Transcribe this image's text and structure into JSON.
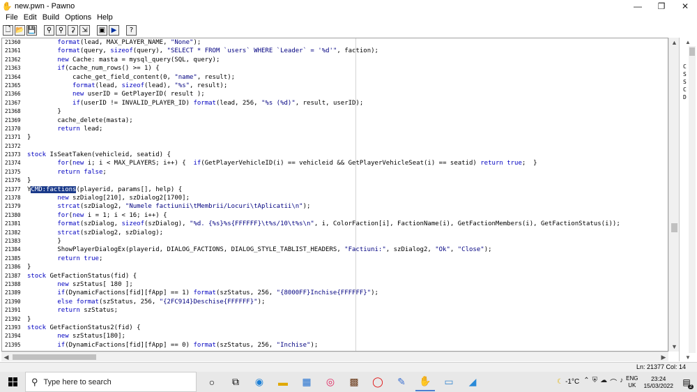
{
  "window": {
    "title": "new.pwn - Pawno",
    "app_icon": "pawno-hand-icon",
    "controls": {
      "minimize": "—",
      "restore": "❐",
      "close": "✕"
    }
  },
  "menu": [
    "File",
    "Edit",
    "Build",
    "Options",
    "Help"
  ],
  "toolbar": {
    "buttons": [
      {
        "name": "new-file-button",
        "icon": "new-icon",
        "glyph": "🗋"
      },
      {
        "name": "open-file-button",
        "icon": "open-folder-icon",
        "glyph": "📂"
      },
      {
        "name": "save-file-button",
        "icon": "save-icon",
        "glyph": "💾"
      },
      {
        "name": "find-button",
        "icon": "binoculars-icon",
        "glyph": "⚲"
      },
      {
        "name": "find-next-button",
        "icon": "find-next-icon",
        "glyph": "⚲"
      },
      {
        "name": "replace-button",
        "icon": "replace-icon",
        "glyph": "⚳"
      },
      {
        "name": "goto-line-button",
        "icon": "goto-icon",
        "glyph": "⇲"
      },
      {
        "name": "compile-button",
        "icon": "compile-icon",
        "glyph": "▣"
      },
      {
        "name": "run-button",
        "icon": "run-icon",
        "glyph": "▶"
      },
      {
        "name": "help-button",
        "icon": "help-icon",
        "glyph": "?"
      }
    ]
  },
  "editor": {
    "lines": [
      {
        "n": "21360",
        "t": "        format(lead, MAX_PLAYER_NAME, \"None\");"
      },
      {
        "n": "21361",
        "t": "        format(query, sizeof(query), \"SELECT * FROM `users` WHERE `Leader` = '%d'\", faction);"
      },
      {
        "n": "21362",
        "t": "        new Cache: masta = mysql_query(SQL, query);"
      },
      {
        "n": "21363",
        "t": "        if(cache_num_rows() >= 1) {"
      },
      {
        "n": "21364",
        "t": "            cache_get_field_content(0, \"name\", result);"
      },
      {
        "n": "21365",
        "t": "            format(lead, sizeof(lead), \"%s\", result);"
      },
      {
        "n": "21366",
        "t": "            new userID = GetPlayerID( result );"
      },
      {
        "n": "21367",
        "t": "            if(userID != INVALID_PLAYER_ID) format(lead, 256, \"%s (%d)\", result, userID);"
      },
      {
        "n": "21368",
        "t": "        }"
      },
      {
        "n": "21369",
        "t": "        cache_delete(masta);"
      },
      {
        "n": "21370",
        "t": "        return lead;"
      },
      {
        "n": "21371",
        "t": "}"
      },
      {
        "n": "21372",
        "t": ""
      },
      {
        "n": "21373",
        "t": "stock IsSeatTaken(vehicleid, seatid) {"
      },
      {
        "n": "21374",
        "t": "        for(new i; i < MAX_PLAYERS; i++) {  if(GetPlayerVehicleID(i) == vehicleid && GetPlayerVehicleSeat(i) == seatid) return true;  }"
      },
      {
        "n": "21375",
        "t": "        return false;"
      },
      {
        "n": "21376",
        "t": "}"
      },
      {
        "n": "21377",
        "t": "YCMD:factions(playerid, params[], help) {"
      },
      {
        "n": "21378",
        "t": "        new szDialog[210], szDialog2[1700];"
      },
      {
        "n": "21379",
        "t": "        strcat(szDialog2, \"Numele factiunii\\tMembrii/Locuri\\tAplicatii\\n\");"
      },
      {
        "n": "21380",
        "t": "        for(new i = 1; i < 16; i++) {"
      },
      {
        "n": "21381",
        "t": "        format(szDialog, sizeof(szDialog), \"%d. {%s}%s{FFFFFF}\\t%s/10\\t%s\\n\", i, ColorFaction[i], FactionName(i), GetFactionMembers(i), GetFactionStatus(i));"
      },
      {
        "n": "21382",
        "t": "        strcat(szDialog2, szDialog);"
      },
      {
        "n": "21383",
        "t": "        }"
      },
      {
        "n": "21384",
        "t": "        ShowPlayerDialogEx(playerid, DIALOG_FACTIONS, DIALOG_STYLE_TABLIST_HEADERS, \"Factiuni:\", szDialog2, \"Ok\", \"Close\");"
      },
      {
        "n": "21385",
        "t": "        return true;"
      },
      {
        "n": "21386",
        "t": "}"
      },
      {
        "n": "21387",
        "t": "stock GetFactionStatus(fid) {"
      },
      {
        "n": "21388",
        "t": "        new szStatus[ 180 ];"
      },
      {
        "n": "21389",
        "t": "        if(DynamicFactions[fid][fApp] == 1) format(szStatus, 256, \"{8000FF}Inchise{FFFFFF}\");"
      },
      {
        "n": "21390",
        "t": "        else format(szStatus, 256, \"{2FC914}Deschise{FFFFFF}\");"
      },
      {
        "n": "21391",
        "t": "        return szStatus;"
      },
      {
        "n": "21392",
        "t": "}"
      },
      {
        "n": "21393",
        "t": "stock GetFactionStatus2(fid) {"
      },
      {
        "n": "21394",
        "t": "        new szStatus[180];"
      },
      {
        "n": "21395",
        "t": "        if(DynamicFactions[fid][fApp] == 0) format(szStatus, 256, \"Inchise\");"
      }
    ],
    "selection": {
      "line": "21377",
      "text": "CMD:factions"
    }
  },
  "side_panel": {
    "items": [
      "C",
      "S",
      "S",
      "C",
      "D"
    ]
  },
  "status": {
    "position": "Ln: 21377   Col: 14"
  },
  "taskbar": {
    "search_placeholder": "Type here to search",
    "weather": "-1°C",
    "lang_top": "ENG",
    "lang_bottom": "UK",
    "time": "23:24",
    "date": "15/03/2022",
    "notifications": "2",
    "apps": [
      {
        "name": "cortana-icon",
        "glyph": "○"
      },
      {
        "name": "task-view-icon",
        "glyph": "⧉"
      },
      {
        "name": "edge-icon",
        "glyph": "◉",
        "color": "#1b7fd6"
      },
      {
        "name": "file-explorer-icon",
        "glyph": "▬",
        "color": "#e0a800"
      },
      {
        "name": "store-icon",
        "glyph": "▦",
        "color": "#1f6fd0"
      },
      {
        "name": "opera-gx-icon",
        "glyph": "◎",
        "color": "#e0245e"
      },
      {
        "name": "game-app-icon",
        "glyph": "▩",
        "color": "#6a3a1a"
      },
      {
        "name": "opera-icon",
        "glyph": "◯",
        "color": "#e01010"
      },
      {
        "name": "paint-icon",
        "glyph": "✎",
        "color": "#3a6fd0"
      },
      {
        "name": "pawno-icon",
        "glyph": "✋",
        "color": "#d8a000",
        "active": true
      },
      {
        "name": "window-app-icon",
        "glyph": "▭",
        "color": "#3a8ad0"
      },
      {
        "name": "cloud-app-icon",
        "glyph": "◢",
        "color": "#2a8ad8"
      }
    ]
  },
  "colors": {
    "selection_bg": "#1a3a8a",
    "keyword": "#0000c0"
  }
}
